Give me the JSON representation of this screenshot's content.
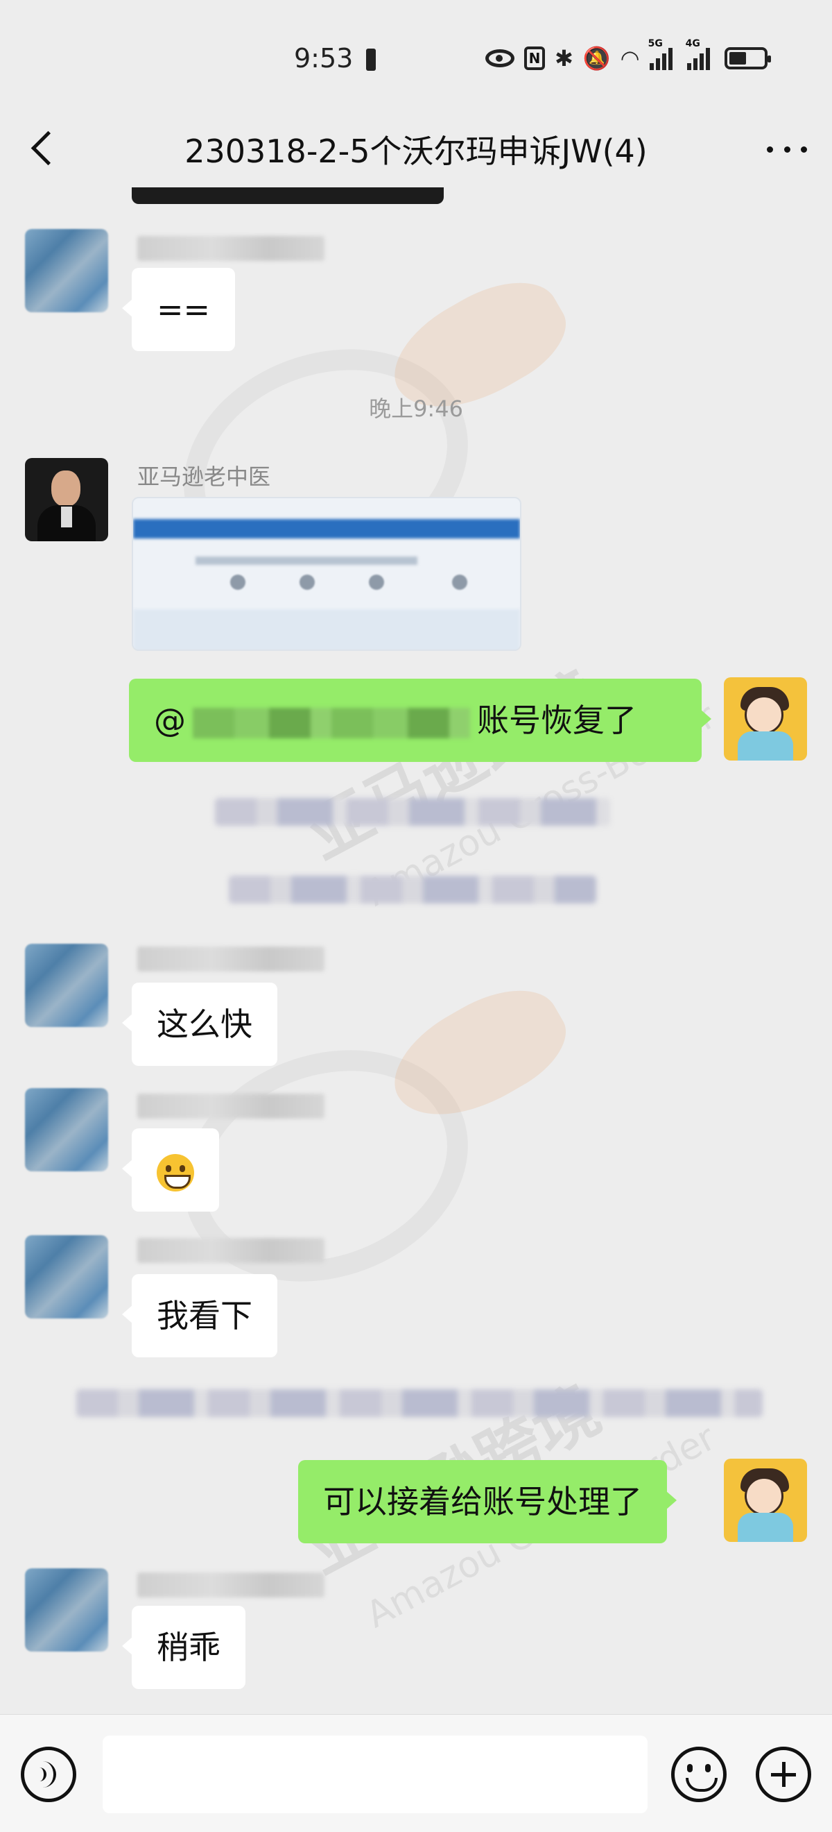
{
  "status_bar": {
    "time": "9:53",
    "icons": [
      "eye-icon",
      "nfc-icon",
      "bluetooth-icon",
      "mute-icon",
      "wifi-icon",
      "signal-5g-icon",
      "signal-4g-icon",
      "battery-icon"
    ],
    "network_5g": "5G",
    "network_4g": "4G"
  },
  "nav": {
    "title": "230318-2-5个沃尔玛申诉JW(4)"
  },
  "messages": {
    "m1_text": "==",
    "timestamp": "晚上9:46",
    "m2_sender": "亚马逊老中医",
    "m3_mention": "@",
    "m3_text": "账号恢复了",
    "m4_text": "这么快",
    "m6_text": "我看下",
    "m7_text": "可以接着给账号处理了",
    "m8_text": "稍乖"
  },
  "watermark": {
    "text": "亚马逊跨境",
    "sub": "Amazou Cross-Border"
  },
  "input_bar": {
    "placeholder": ""
  },
  "colors": {
    "background": "#ededed",
    "bubble_in": "#ffffff",
    "bubble_out": "#95ec69",
    "text": "#111111",
    "muted": "#9a9a9a"
  }
}
